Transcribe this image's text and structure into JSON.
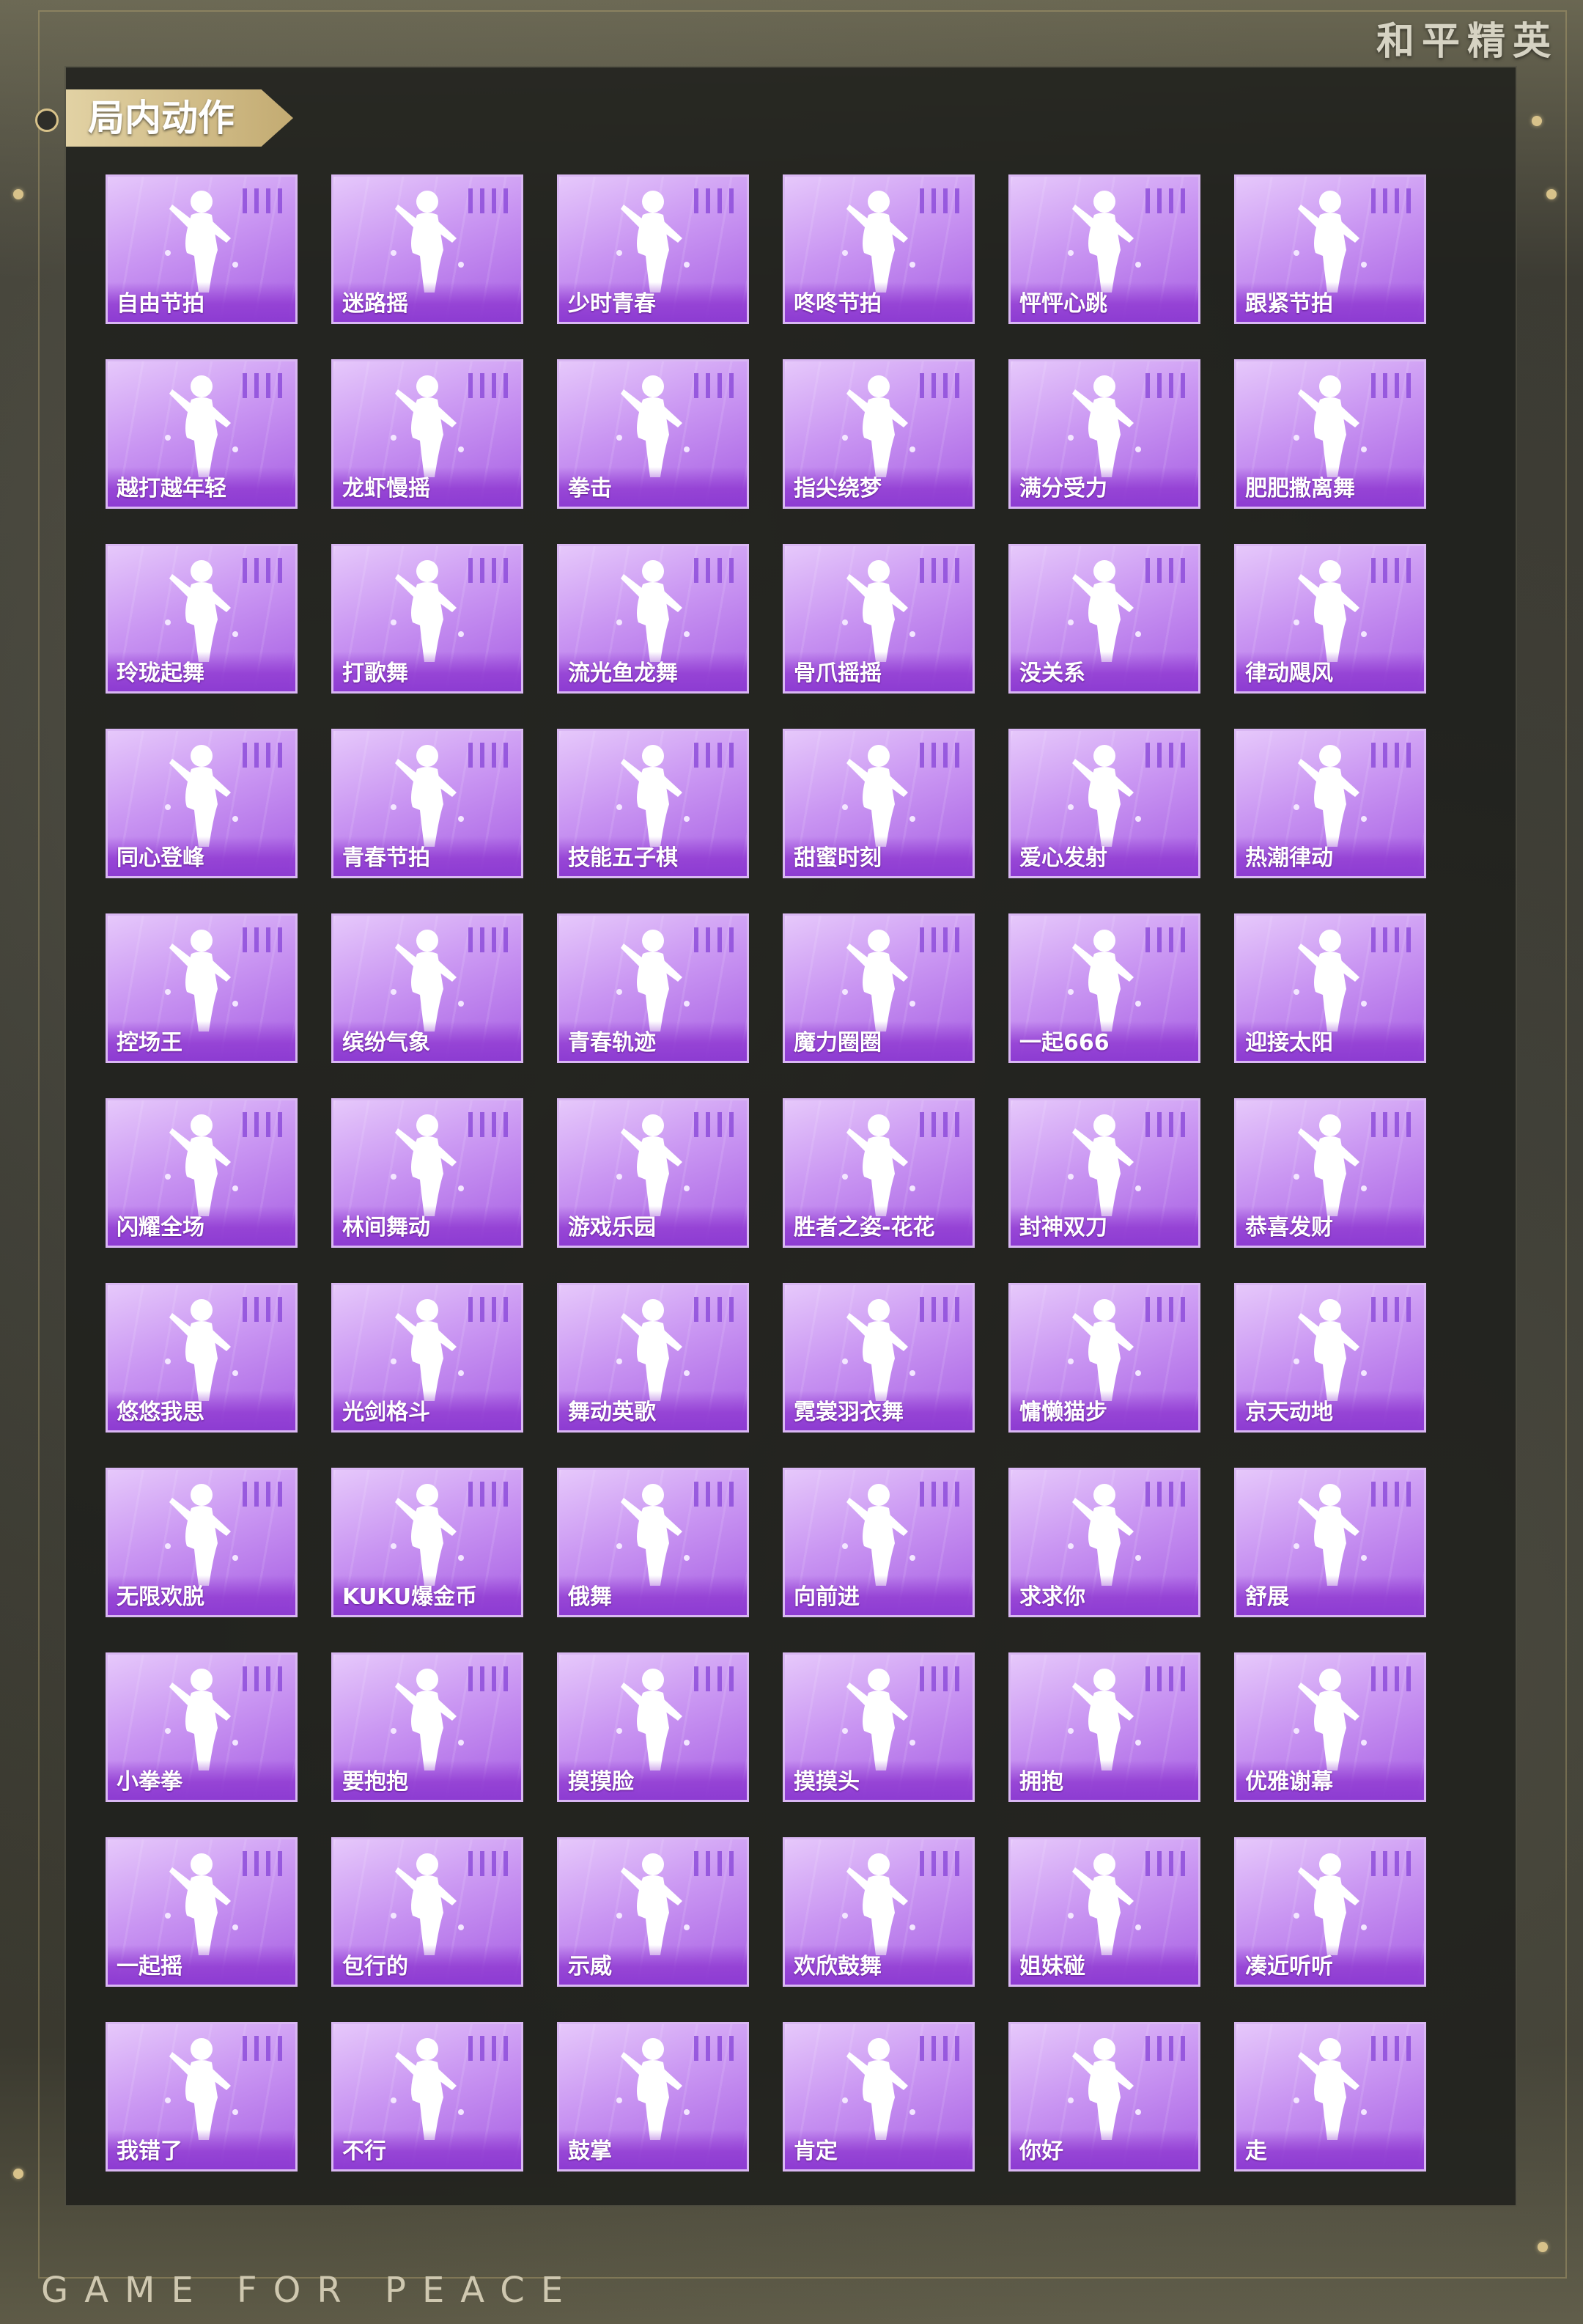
{
  "brand": "和平精英",
  "section_title": "局内动作",
  "footer": "GAME FOR PEACE",
  "colors": {
    "tile_top": "#e6c8fb",
    "tile_bottom": "#a75fe3",
    "tile_border": "#d9b7f3",
    "title_tab": "#d2bd88"
  },
  "emotes": [
    "自由节拍",
    "迷路摇",
    "少时青春",
    "咚咚节拍",
    "怦怦心跳",
    "跟紧节拍",
    "越打越年轻",
    "龙虾慢摇",
    "拳击",
    "指尖绕梦",
    "满分受力",
    "肥肥撒离舞",
    "玲珑起舞",
    "打歌舞",
    "流光鱼龙舞",
    "骨爪摇摇",
    "没关系",
    "律动飓风",
    "同心登峰",
    "青春节拍",
    "技能五子棋",
    "甜蜜时刻",
    "爱心发射",
    "热潮律动",
    "控场王",
    "缤纷气象",
    "青春轨迹",
    "魔力圈圈",
    "一起666",
    "迎接太阳",
    "闪耀全场",
    "林间舞动",
    "游戏乐园",
    "胜者之姿-花花",
    "封神双刀",
    "恭喜发财",
    "悠悠我思",
    "光剑格斗",
    "舞动英歌",
    "霓裳羽衣舞",
    "慵懒猫步",
    "京天动地",
    "无限欢脱",
    "KUKU爆金币",
    "俄舞",
    "向前进",
    "求求你",
    "舒展",
    "小拳拳",
    "要抱抱",
    "摸摸脸",
    "摸摸头",
    "拥抱",
    "优雅谢幕",
    "一起摇",
    "包行的",
    "示威",
    "欢欣鼓舞",
    "姐妹碰",
    "凑近听听",
    "我错了",
    "不行",
    "鼓掌",
    "肯定",
    "你好",
    "走"
  ]
}
